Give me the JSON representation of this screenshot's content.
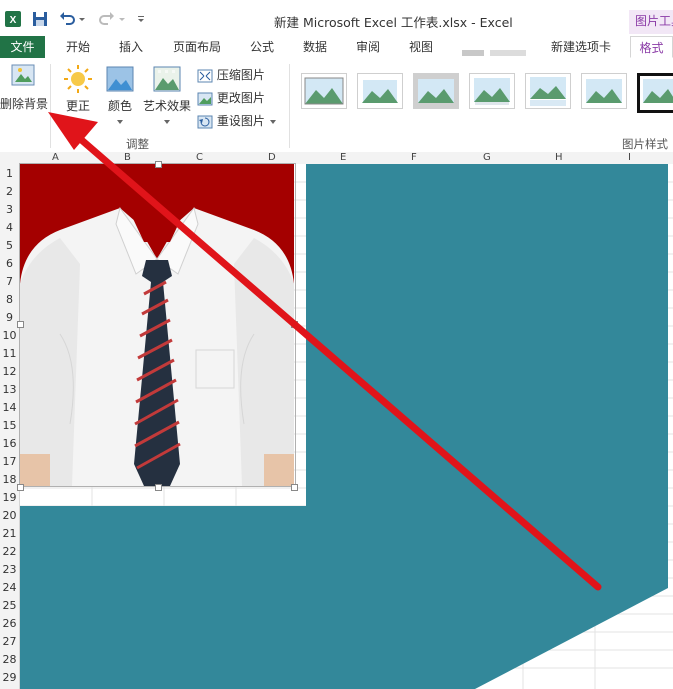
{
  "quick_access": {
    "app_icon": "excel-icon",
    "save_icon": "save-icon",
    "undo_icon": "undo-icon",
    "redo_icon": "redo-icon",
    "customize_icon": "customize-qat-icon"
  },
  "window": {
    "title": "新建 Microsoft Excel 工作表.xlsx - Excel",
    "context_tab_group": "图片工具"
  },
  "tabs": [
    {
      "label": "文件"
    },
    {
      "label": "开始"
    },
    {
      "label": "插入"
    },
    {
      "label": "页面布局"
    },
    {
      "label": "公式"
    },
    {
      "label": "数据"
    },
    {
      "label": "审阅"
    },
    {
      "label": "视图"
    },
    {
      "label": "新建选项卡"
    },
    {
      "label": "格式"
    }
  ],
  "ribbon": {
    "remove_background": "删除背景",
    "corrections": "更正",
    "color": "颜色",
    "artistic_effects": "艺术效果",
    "compress": "压缩图片",
    "change": "更改图片",
    "reset": "重设图片",
    "adjust_group": "调整",
    "styles_group": "图片样式"
  },
  "columns": [
    "A",
    "B",
    "C",
    "D",
    "E",
    "F",
    "G",
    "H",
    "I"
  ],
  "rows": [
    "1",
    "2",
    "3",
    "4",
    "5",
    "6",
    "7",
    "8",
    "9",
    "10",
    "11",
    "12",
    "13",
    "14",
    "15",
    "16",
    "17",
    "18",
    "19",
    "20",
    "21",
    "22",
    "23",
    "24",
    "25",
    "26",
    "27",
    "28",
    "29"
  ],
  "colors": {
    "excel_green": "#217346",
    "context_purple": "#8a3aa6",
    "teal_background": "#33889a",
    "photo_red": "#a40000",
    "arrow_red": "#e0141a"
  }
}
